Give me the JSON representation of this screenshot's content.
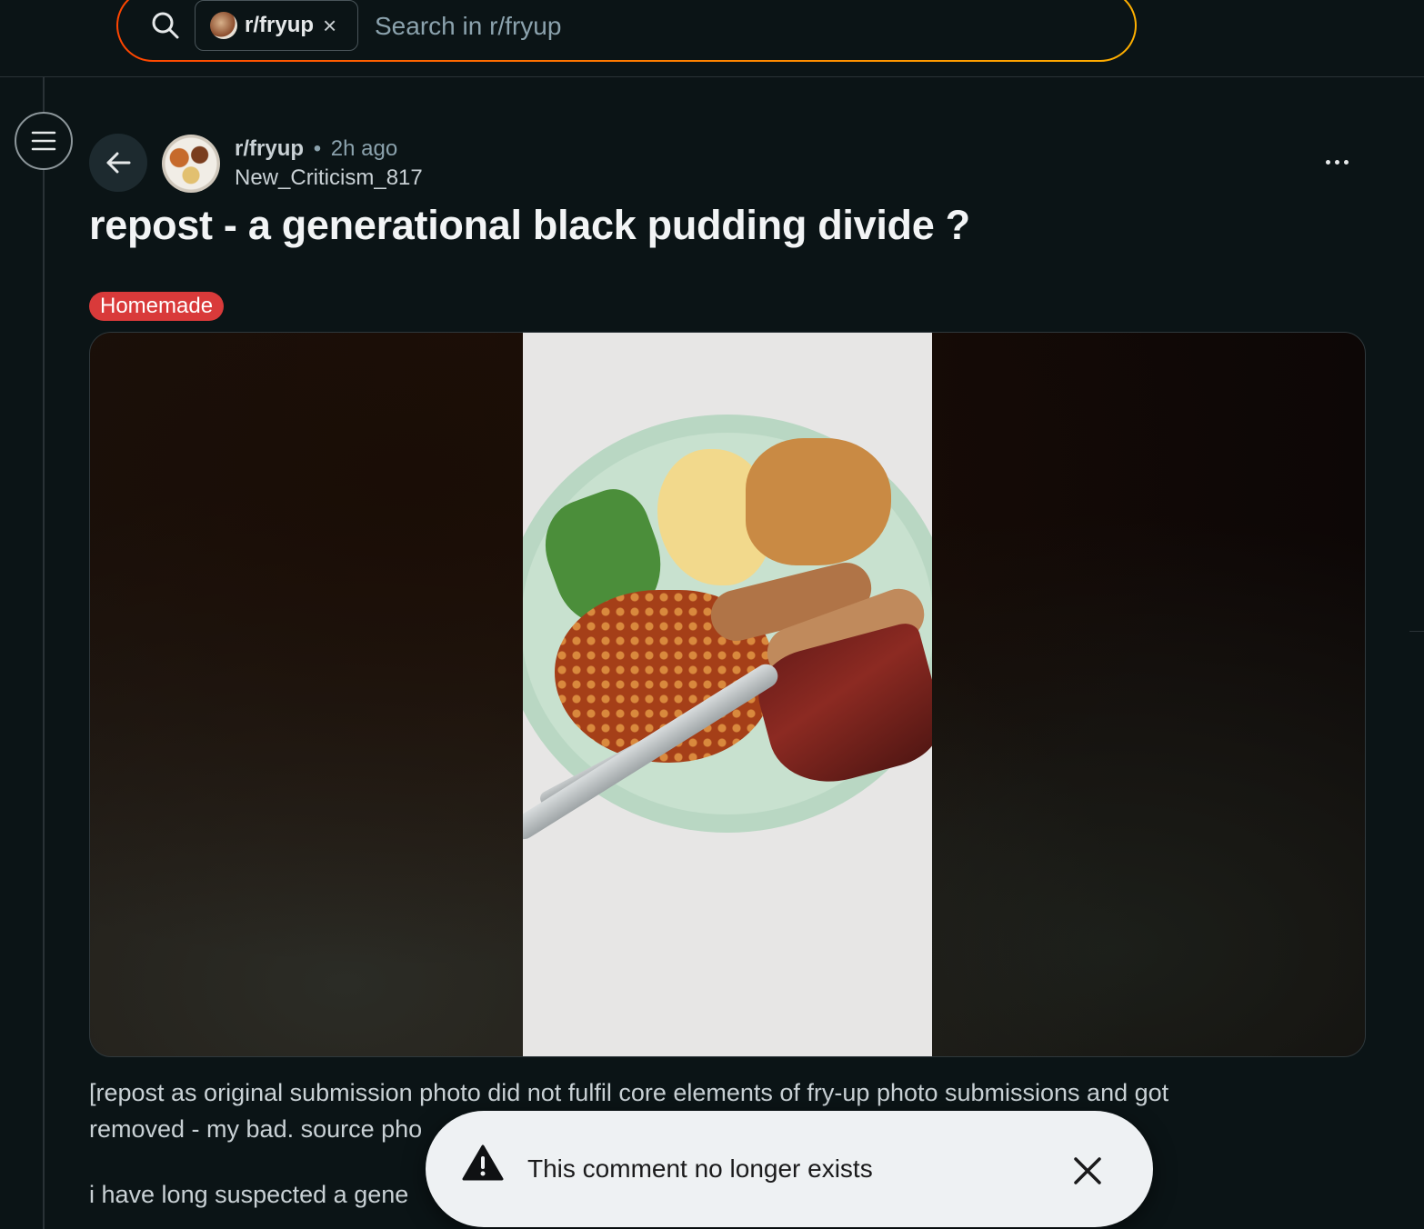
{
  "search": {
    "chip_label": "r/fryup",
    "placeholder": "Search in r/fryup"
  },
  "post": {
    "subreddit": "r/fryup",
    "separator": "•",
    "time": "2h ago",
    "author": "New_Criticism_817",
    "title": "repost - a generational black pudding divide ?",
    "flair": "Homemade",
    "flair_color": "#d93a3a",
    "body_line1": "[repost as original submission photo did not fulfil core elements of fry-up photo submissions and got",
    "body_line2": "removed - my bad. source pho",
    "body_line3": "i have long suspected a gene"
  },
  "toast": {
    "message": "This comment no longer exists"
  },
  "icons": {
    "search": "search-icon",
    "close_chip": "close-icon",
    "menu": "hamburger-menu-icon",
    "back": "arrow-left-icon",
    "more": "more-options-icon",
    "warning": "warning-icon",
    "close_toast": "close-icon"
  },
  "colors": {
    "background": "#0b1416",
    "accent_gradient_start": "#ff4500",
    "accent_gradient_end": "#ffb000"
  }
}
